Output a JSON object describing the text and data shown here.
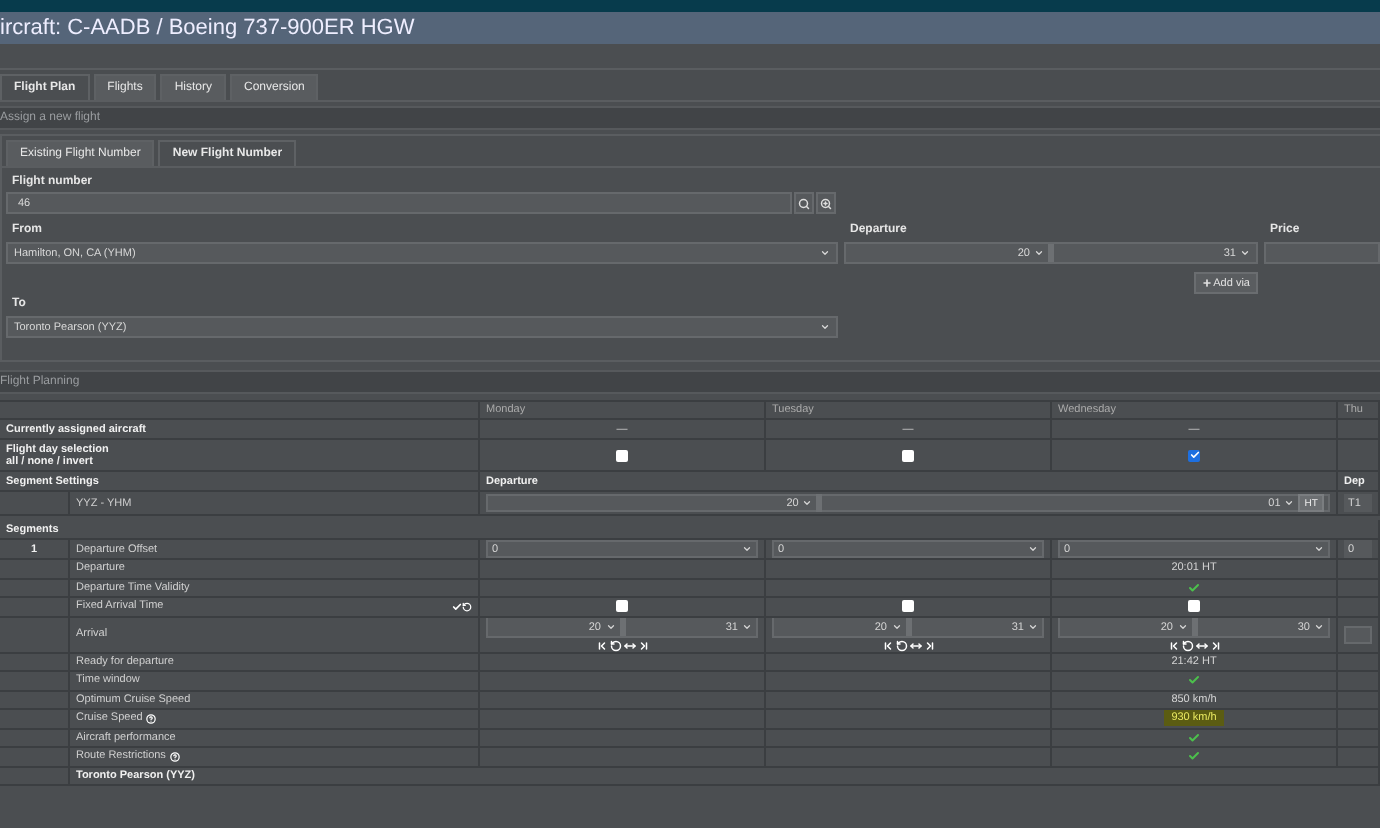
{
  "window": {
    "title": "ircraft: C-AADB / Boeing 737-900ER HGW"
  },
  "tabs": [
    {
      "label": "Flight Plan",
      "selected": true
    },
    {
      "label": "Flights",
      "selected": false
    },
    {
      "label": "History",
      "selected": false
    },
    {
      "label": "Conversion",
      "selected": false
    }
  ],
  "assign": {
    "title": "Assign a new flight",
    "sub_tabs": [
      {
        "label": "Existing Flight Number",
        "selected": false
      },
      {
        "label": "New Flight Number",
        "selected": true
      }
    ],
    "flight_number": {
      "label": "Flight number",
      "value": "46"
    },
    "from": {
      "label": "From",
      "value": "Hamilton, ON, CA (YHM)"
    },
    "departure": {
      "label": "Departure",
      "hour": "20",
      "minute": "31"
    },
    "price": {
      "label": "Price"
    },
    "add_via": "Add via",
    "to": {
      "label": "To",
      "value": "Toronto Pearson (YYZ)"
    }
  },
  "planning": {
    "title": "Flight Planning",
    "days": [
      "Monday",
      "Tuesday",
      "Wednesday",
      "Thu"
    ],
    "assigned": {
      "label": "Currently assigned aircraft",
      "values": [
        "—",
        "—",
        "—"
      ]
    },
    "day_selection": {
      "label": "Flight day selection",
      "links": "all / none / invert",
      "checked": [
        false,
        false,
        true
      ]
    },
    "segment_settings": {
      "label": "Segment Settings",
      "headers": [
        "Departure",
        "Dep"
      ]
    },
    "route": {
      "label": "YYZ - YHM",
      "hour": "20",
      "minute": "01",
      "zone": "HT",
      "next_value": "T1"
    },
    "segments_label": "Segments",
    "segment": {
      "number": "1",
      "rows": [
        {
          "kind": "select",
          "label": "Departure Offset",
          "values": [
            "0",
            "0",
            "0",
            "0"
          ]
        },
        {
          "kind": "text",
          "label": "Departure",
          "cells": [
            null,
            null,
            {
              "text": "20:01 HT",
              "highlighted": false
            }
          ]
        },
        {
          "kind": "check",
          "label": "Departure Time Validity",
          "checks": [
            false,
            false,
            true
          ]
        },
        {
          "kind": "checkbox",
          "label": "Fixed Arrival Time",
          "actions": true,
          "checked": [
            false,
            false,
            false
          ]
        },
        {
          "kind": "arrival",
          "label": "Arrival",
          "cells": [
            {
              "hour": "20",
              "minute": "31"
            },
            {
              "hour": "20",
              "minute": "31"
            },
            {
              "hour": "20",
              "minute": "30"
            }
          ]
        },
        {
          "kind": "text",
          "label": "Ready for departure",
          "cells": [
            null,
            null,
            {
              "text": "21:42 HT",
              "highlighted": false
            }
          ]
        },
        {
          "kind": "check",
          "label": "Time window",
          "checks": [
            false,
            false,
            true
          ]
        },
        {
          "kind": "text",
          "label": "Optimum Cruise Speed",
          "cells": [
            null,
            null,
            {
              "text": "850 km/h",
              "highlighted": false
            }
          ]
        },
        {
          "kind": "text",
          "label": "Cruise Speed",
          "help": true,
          "cells": [
            null,
            null,
            {
              "text": "930 km/h",
              "highlighted": true
            }
          ]
        },
        {
          "kind": "check",
          "label": "Aircraft performance",
          "checks": [
            false,
            false,
            true
          ]
        },
        {
          "kind": "check",
          "label": "Route Restrictions",
          "help": true,
          "checks": [
            false,
            false,
            true
          ]
        }
      ]
    },
    "destination": "Toronto Pearson (YYZ)"
  }
}
